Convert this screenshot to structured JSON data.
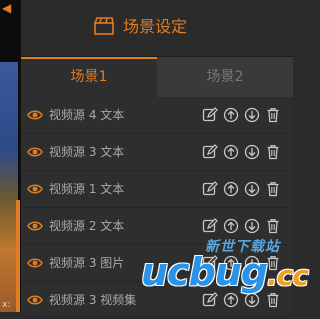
{
  "preview": {
    "corner_text": "x:"
  },
  "header": {
    "title": "场景设定",
    "icon": "clapperboard-icon"
  },
  "tabs": [
    {
      "label": "场景1",
      "active": true
    },
    {
      "label": "场景2",
      "active": false
    }
  ],
  "sources": [
    {
      "label": "视频源 4 文本"
    },
    {
      "label": "视频源 3 文本"
    },
    {
      "label": "视频源 1 文本"
    },
    {
      "label": "视频源 2 文本"
    },
    {
      "label": "视频源 3 图片"
    },
    {
      "label": "视频源 3 视频集"
    }
  ],
  "watermark": {
    "sub": "新世下载站",
    "main": "ucbug",
    "suffix": ".cc"
  },
  "colors": {
    "accent": "#e07c24",
    "text": "#aaaaaa",
    "icon": "#c8c8c8"
  }
}
